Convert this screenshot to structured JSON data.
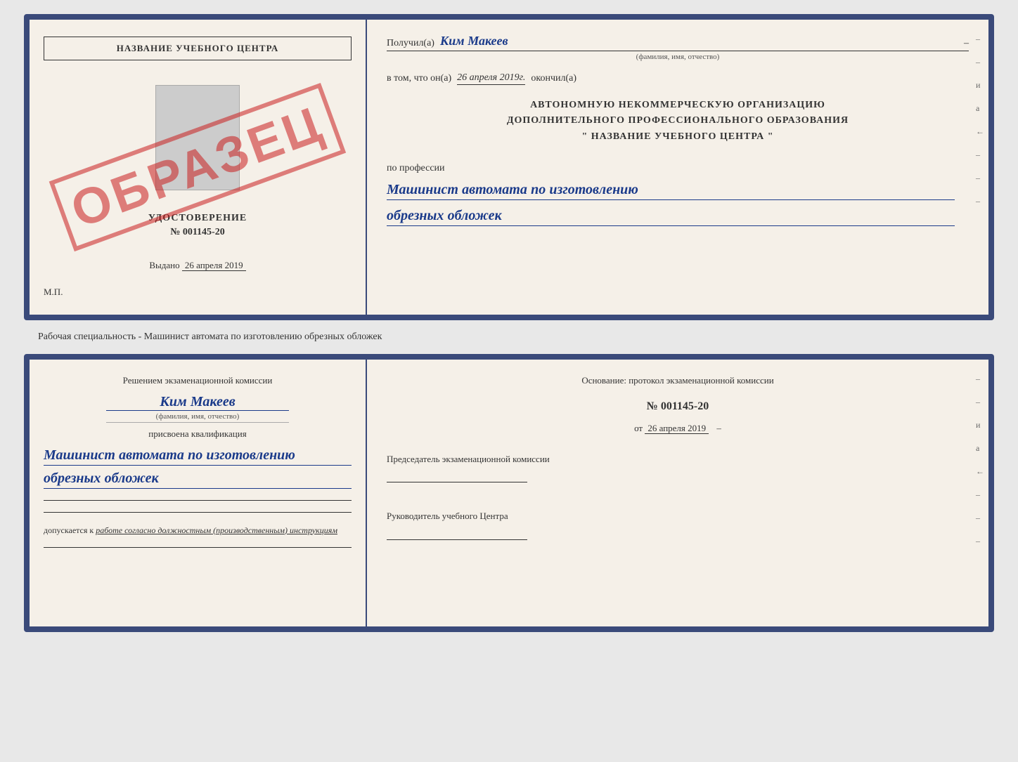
{
  "top_card": {
    "left": {
      "school_name": "НАЗВАНИЕ УЧЕБНОГО ЦЕНТРА",
      "obrazec_text": "ОБРАЗЕЦ",
      "udostoverenie_title": "УДОСТОВЕРЕНИЕ",
      "udostoverenie_number": "№ 001145-20",
      "vydano_label": "Выдано",
      "vydano_date": "26 апреля 2019",
      "mp_label": "М.П."
    },
    "right": {
      "poluchil_label": "Получил(а)",
      "recipient_name": "Ким Макеев",
      "fio_label": "(фамилия, имя, отчество)",
      "dash": "–",
      "vtom_label": "в том, что он(а)",
      "completion_date": "26 апреля 2019г.",
      "okonchil_label": "окончил(а)",
      "org_line1": "АВТОНОМНУЮ НЕКОММЕРЧЕСКУЮ ОРГАНИЗАЦИЮ",
      "org_line2": "ДОПОЛНИТЕЛЬНОГО ПРОФЕССИОНАЛЬНОГО ОБРАЗОВАНИЯ",
      "org_line3": "\"  НАЗВАНИЕ УЧЕБНОГО ЦЕНТРА  \"",
      "po_professii": "по профессии",
      "profession_line1": "Машинист автомата по изготовлению",
      "profession_line2": "обрезных обложек"
    }
  },
  "specialty_caption": "Рабочая специальность - Машинист автомата по изготовлению обрезных обложек",
  "bottom_card": {
    "left": {
      "resheniem_label": "Решением экзаменационной комиссии",
      "name_handwritten": "Ким Макеев",
      "fio_label": "(фамилия, имя, отчество)",
      "prisvoena_label": "присвоена квалификация",
      "kvalifikaciya_line1": "Машинист автомата по изготовлению",
      "kvalifikaciya_line2": "обрезных обложек",
      "dopuskaetsya_label": "допускается к",
      "dopuskaetsya_text": "работе согласно должностным (производственным) инструкциям"
    },
    "right": {
      "osnovanie_label": "Основание: протокол экзаменационной комиссии",
      "protocol_number": "№ 001145-20",
      "ot_label": "от",
      "ot_date": "26 апреля 2019",
      "predsedatel_label": "Председатель экзаменационной комиссии",
      "rukovoditel_label": "Руководитель учебного Центра"
    }
  },
  "right_margin_chars": [
    "и",
    "а",
    "←",
    "–",
    "–",
    "–",
    "–"
  ]
}
